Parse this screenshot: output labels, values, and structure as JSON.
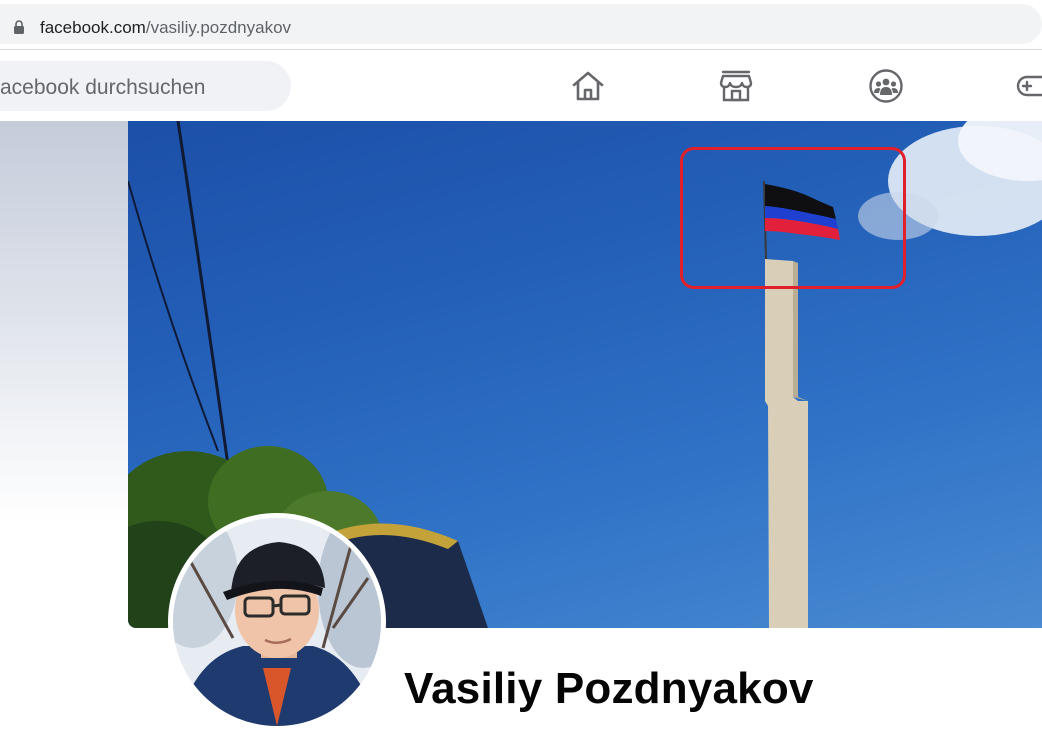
{
  "browser": {
    "url_domain": "facebook.com",
    "url_path": "/vasiliy.pozdnyakov"
  },
  "nav": {
    "search_placeholder": "acebook durchsuchen",
    "icons": [
      "home-icon",
      "marketplace-icon",
      "groups-icon",
      "gaming-icon"
    ]
  },
  "profile": {
    "name": "Vasiliy Pozdnyakov"
  },
  "colors": {
    "highlight": "#e0212b",
    "sky": "#2460b8"
  }
}
